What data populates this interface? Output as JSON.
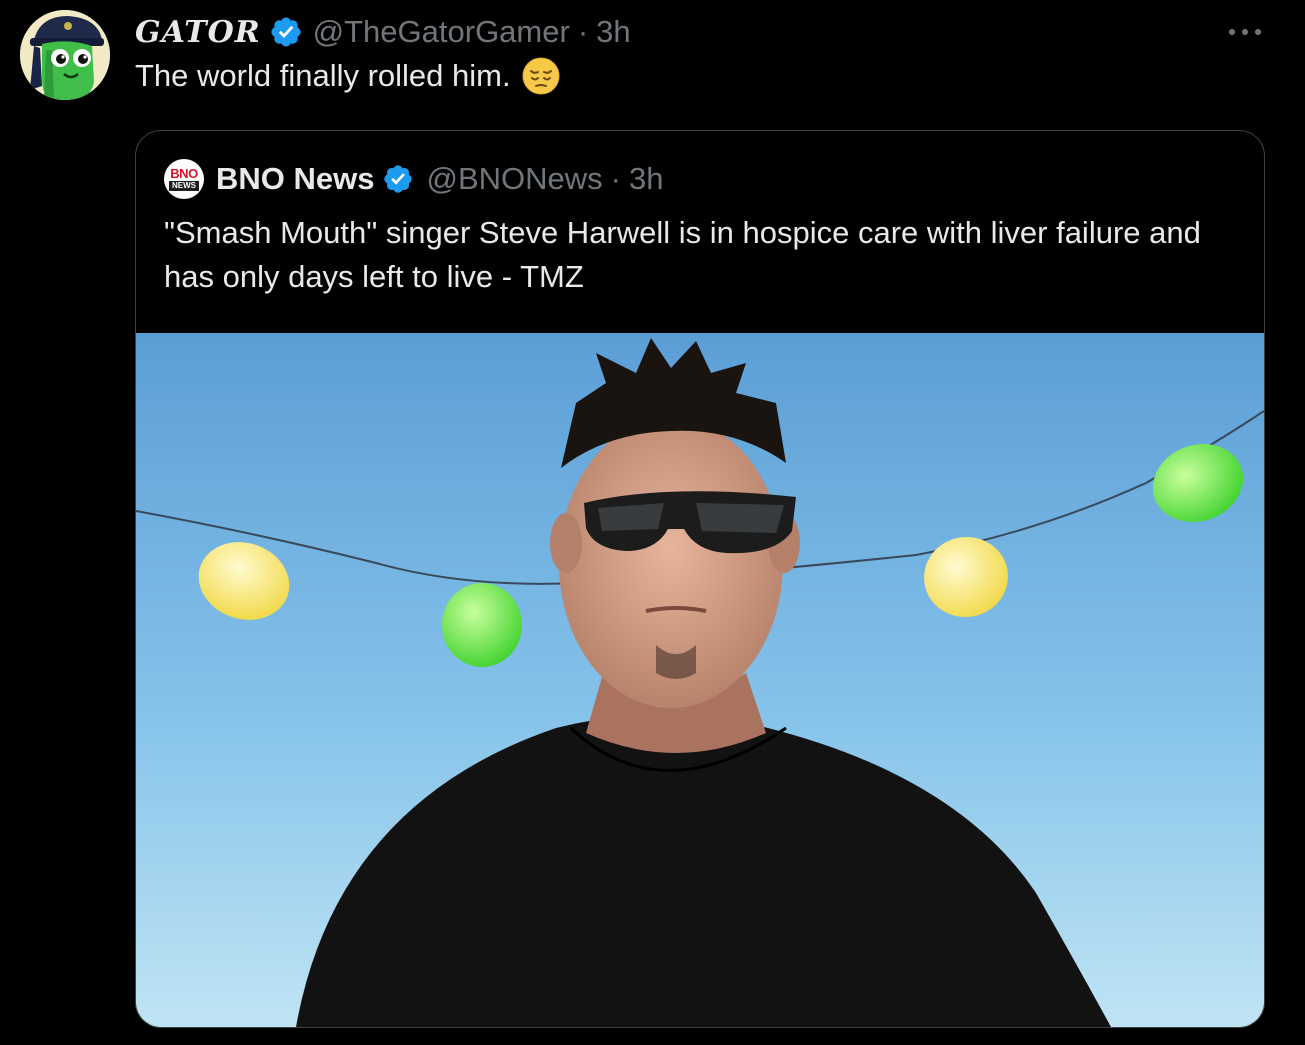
{
  "tweet": {
    "display_name": "GATOR",
    "handle": "@TheGatorGamer",
    "separator": "·",
    "time": "3h",
    "text": "The world finally rolled him.",
    "emoji_icon": "pensive-face-emoji",
    "avatar_icon": "cartoon-gator-avatar",
    "verified_icon": "verified-badge-icon",
    "more_icon": "more-options-icon"
  },
  "quote": {
    "logo_line1": "BNO",
    "logo_line2": "NEWS",
    "display_name": "BNO News",
    "handle": "@BNONews",
    "separator": "·",
    "time": "3h",
    "text": "\"Smash Mouth\" singer Steve Harwell is in hospice care with liver failure and has only days left to live - TMZ",
    "media_alt": "man in sunglasses and black shirt against blue sky with hanging lanterns"
  },
  "colors": {
    "background": "#000000",
    "text_primary": "#e7e9ea",
    "text_secondary": "#71767b",
    "verified_blue": "#1d9bf0",
    "quote_border": "#3e4144",
    "bno_red": "#d7142b"
  }
}
